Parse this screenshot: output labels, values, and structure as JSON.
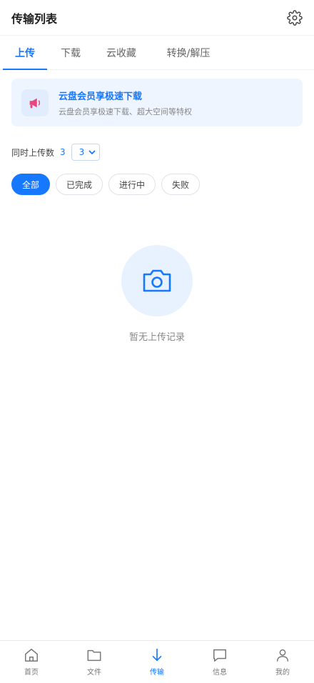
{
  "header": {
    "title": "传输列表",
    "settings_icon": "gear-icon"
  },
  "tabs": [
    {
      "label": "上传",
      "active": true
    },
    {
      "label": "下载",
      "active": false
    },
    {
      "label": "云收藏",
      "active": false
    },
    {
      "label": "转换/解压",
      "active": false
    }
  ],
  "banner": {
    "icon": "megaphone-icon",
    "title": "云盘会员享极速下载",
    "subtitle": "云盘会员享极速下载、超大空间等特权"
  },
  "concurrency": {
    "label": "同时上传数",
    "value": "3",
    "selected": "3"
  },
  "filters": [
    {
      "label": "全部",
      "active": true
    },
    {
      "label": "已完成",
      "active": false
    },
    {
      "label": "进行中",
      "active": false
    },
    {
      "label": "失败",
      "active": false
    }
  ],
  "empty": {
    "icon": "camera-icon",
    "text": "暂无上传记录"
  },
  "bottom_nav": [
    {
      "label": "首页",
      "icon": "home-icon",
      "active": false
    },
    {
      "label": "文件",
      "icon": "folder-icon",
      "active": false
    },
    {
      "label": "传输",
      "icon": "arrow-down-icon",
      "active": true
    },
    {
      "label": "信息",
      "icon": "message-icon",
      "active": false
    },
    {
      "label": "我的",
      "icon": "user-icon",
      "active": false
    }
  ],
  "colors": {
    "accent": "#1677ff",
    "banner_bg": "#eef5ff",
    "empty_bg": "#e8f1fe"
  }
}
